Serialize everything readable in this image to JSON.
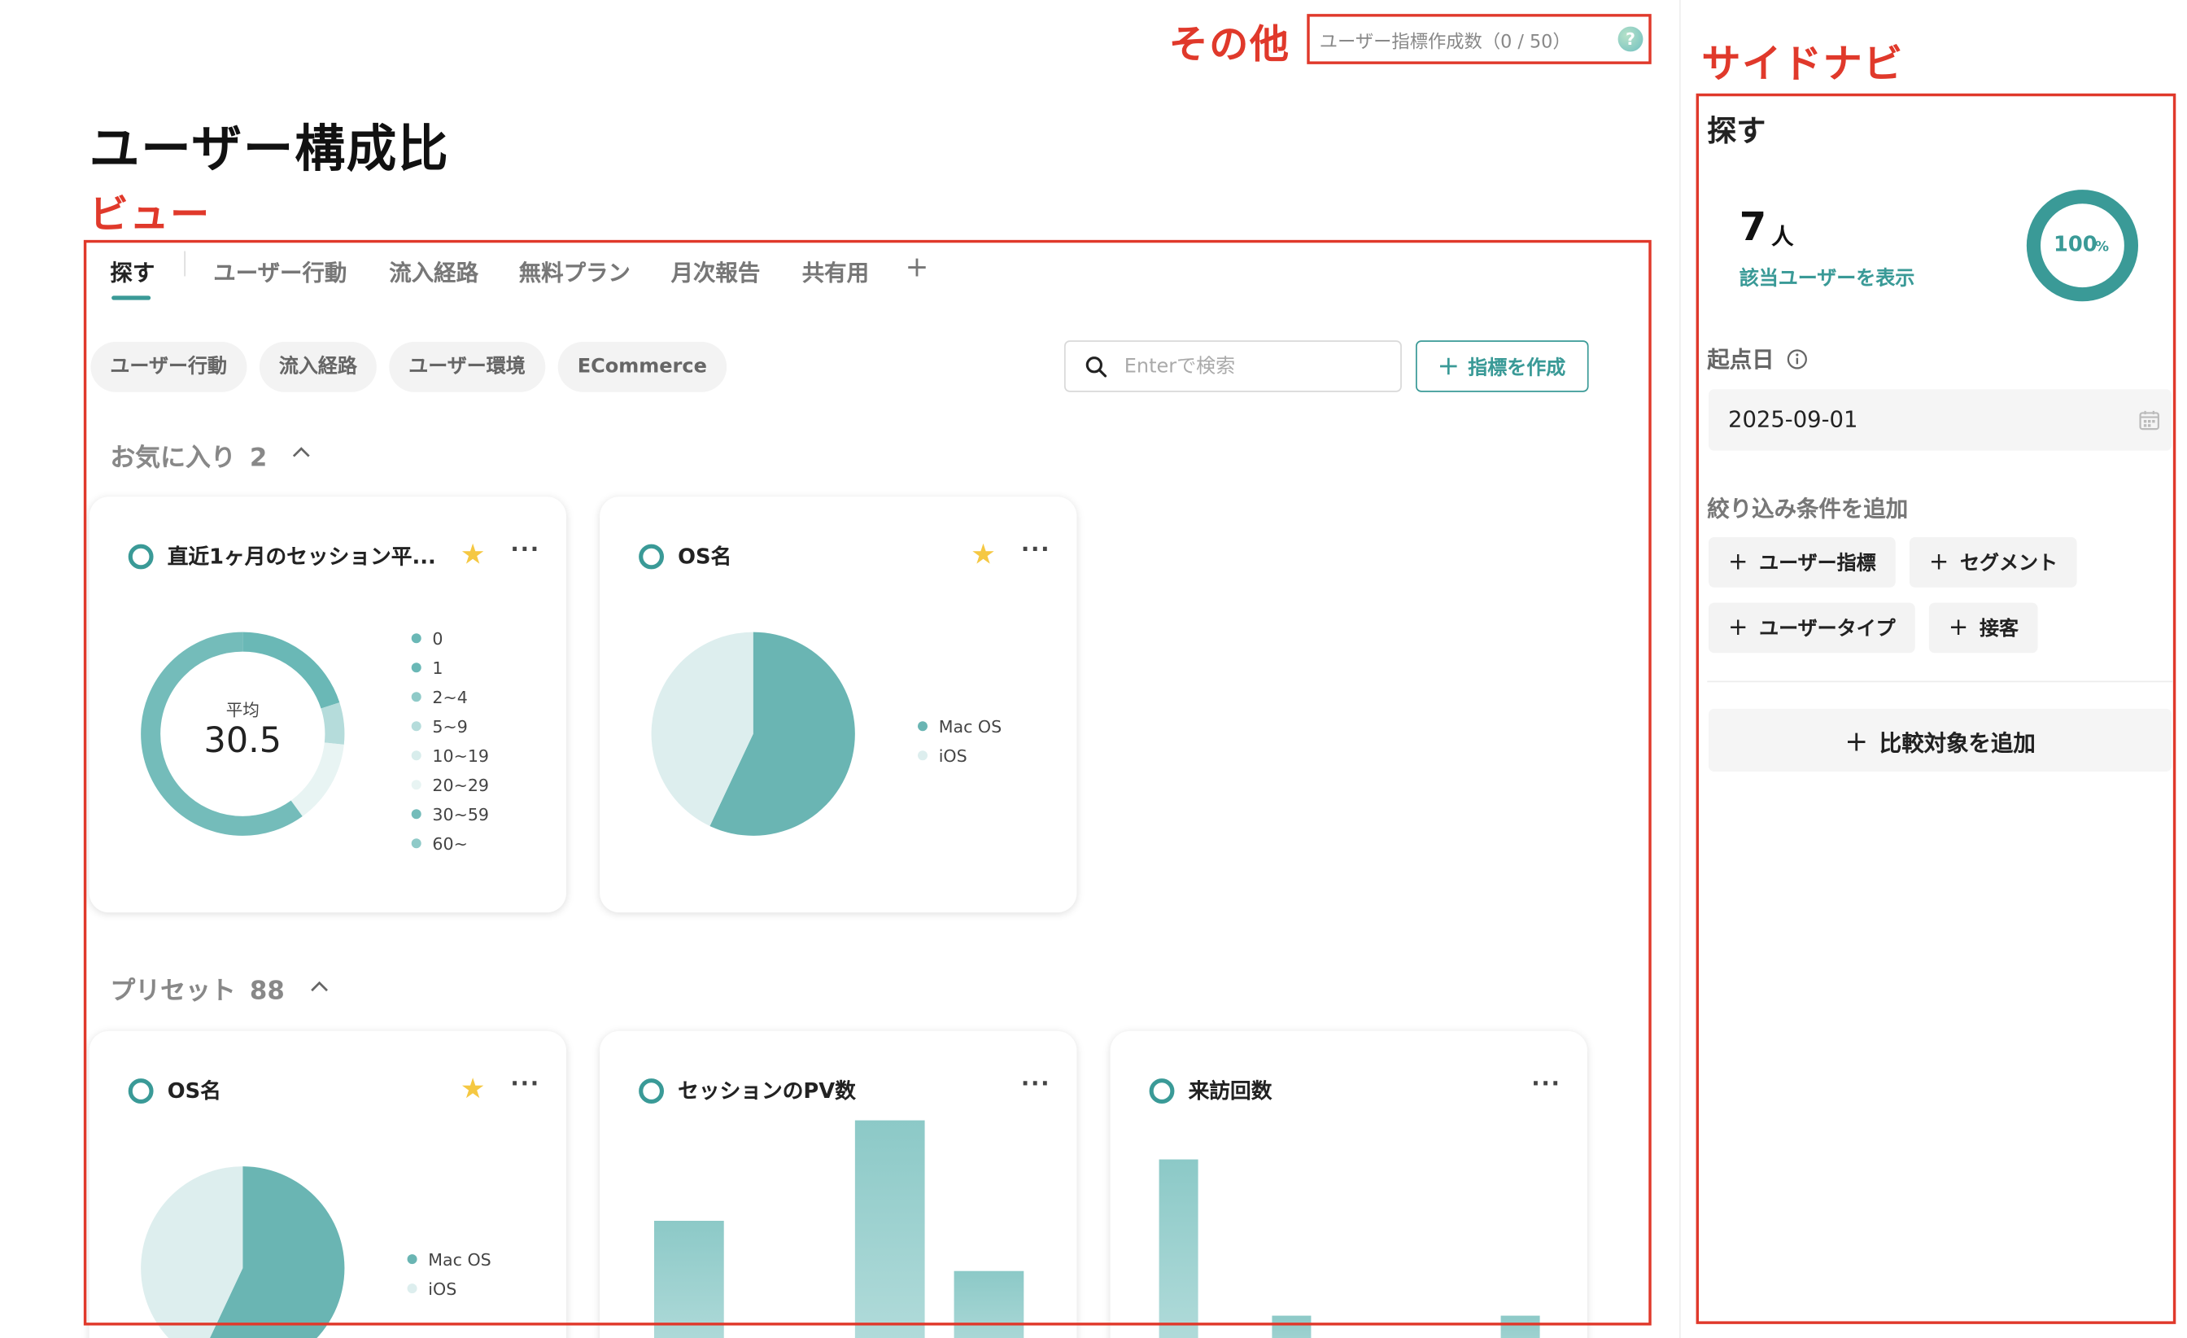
{
  "annotations": {
    "other": "その他",
    "side_nav": "サイドナビ",
    "view": "ビュー"
  },
  "quota": {
    "label": "ユーザー指標作成数（0 / 50）",
    "help": "?"
  },
  "page_title": "ユーザー構成比",
  "tabs": [
    {
      "label": "探す",
      "active": true
    },
    {
      "label": "ユーザー行動"
    },
    {
      "label": "流入経路"
    },
    {
      "label": "無料プラン"
    },
    {
      "label": "月次報告"
    },
    {
      "label": "共有用"
    }
  ],
  "add_tab": "+",
  "chips": [
    "ユーザー行動",
    "流入経路",
    "ユーザー環境",
    "ECommerce"
  ],
  "search": {
    "placeholder": "Enterで検索"
  },
  "create_button": "指標を作成",
  "favorites": {
    "label": "お気に入り",
    "count": "2"
  },
  "presets": {
    "label": "プリセット",
    "count": "88"
  },
  "cards": {
    "fav1": {
      "title": "直近1ヶ月のセッション平...",
      "starred": true,
      "center_label": "平均",
      "center_value": "30.5",
      "legend": [
        "0",
        "1",
        "2~4",
        "5~9",
        "10~19",
        "20~29",
        "30~59",
        "60~"
      ]
    },
    "fav2": {
      "title": "OS名",
      "starred": true,
      "legend": [
        "Mac OS",
        "iOS"
      ]
    },
    "pre1": {
      "title": "OS名",
      "starred": true,
      "legend": [
        "Mac OS",
        "iOS"
      ]
    },
    "pre2": {
      "title": "セッションのPV数",
      "starred": false
    },
    "pre3": {
      "title": "来訪回数",
      "starred": false
    }
  },
  "more_icon": "···",
  "star_icon": "★",
  "chart_data": [
    {
      "type": "pie",
      "subtype": "donut",
      "title": "直近1ヶ月のセッション平...",
      "center_label": "平均",
      "center_value": 30.5,
      "categories": [
        "0",
        "1",
        "2~4",
        "5~9",
        "10~19",
        "20~29",
        "30~59",
        "60~"
      ],
      "values": [
        0,
        3,
        0,
        1,
        0,
        2,
        9,
        0
      ],
      "colors": [
        "#6ab8b6",
        "#6ab8b6",
        "#8fcac8",
        "#b5dcdb",
        "#d8edec",
        "#e8f4f3",
        "#74bcba",
        "#8fcac8"
      ]
    },
    {
      "type": "pie",
      "title": "OS名",
      "categories": [
        "Mac OS",
        "iOS"
      ],
      "values": [
        57,
        43
      ],
      "colors": [
        "#6ab5b3",
        "#ddeeee"
      ]
    },
    {
      "type": "pie",
      "title": "OS名",
      "categories": [
        "Mac OS",
        "iOS"
      ],
      "values": [
        57,
        43
      ],
      "colors": [
        "#6ab5b3",
        "#ddeeee"
      ]
    },
    {
      "type": "bar",
      "title": "セッションのPV数",
      "values": [
        2,
        4,
        1
      ]
    },
    {
      "type": "bar",
      "title": "来訪回数",
      "values": [
        5,
        1,
        1
      ]
    }
  ],
  "side": {
    "title": "探す",
    "user_count": "7",
    "user_unit": "人",
    "show_users": "該当ユーザーを表示",
    "percent": "100",
    "percent_unit": "%",
    "start_label": "起点日",
    "start_date": "2025-09-01",
    "filter_label": "絞り込み条件を追加",
    "filters": [
      "ユーザー指標",
      "セグメント",
      "ユーザータイプ",
      "接客"
    ],
    "compare": "比較対象を追加"
  },
  "colors": {
    "accent": "#3a9a97",
    "annotation": "#e0392b"
  }
}
